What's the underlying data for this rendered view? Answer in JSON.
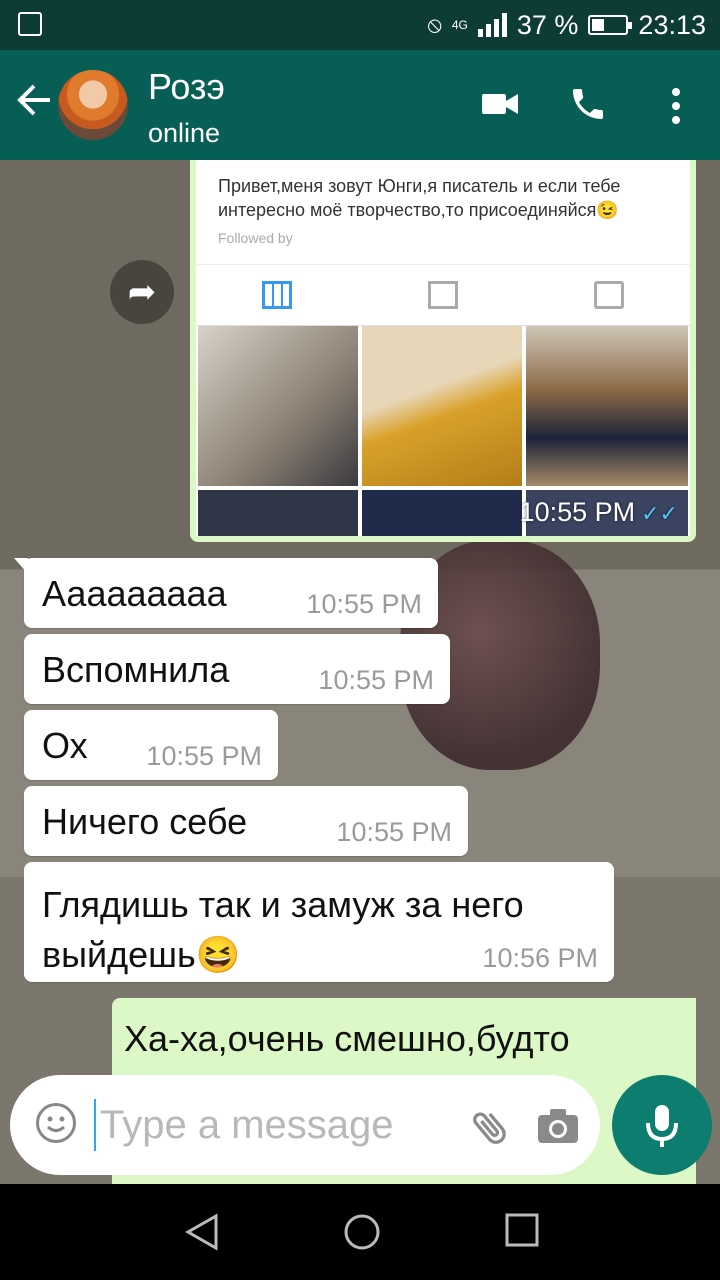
{
  "status": {
    "battery": "37 %",
    "time": "23:13",
    "network": "4G"
  },
  "header": {
    "title": "Розэ",
    "subtitle": "online"
  },
  "image_message": {
    "bio": "Привет,меня зовут Юнги,я писатель и если тебе интересно моё творчество,то присоединяйся😉",
    "followed_by": "Followed by",
    "time": "10:55 PM",
    "ticks": "✓✓"
  },
  "messages": [
    {
      "text": "Аааааааaa",
      "time": "10:55 PM"
    },
    {
      "text": "Вспомнила",
      "time": "10:55 PM"
    },
    {
      "text": "Ох",
      "time": "10:55 PM"
    },
    {
      "text": "Ничего себе",
      "time": "10:55 PM"
    },
    {
      "text": "Глядишь так и замуж за него выйдешь😆",
      "time": "10:56 PM"
    }
  ],
  "outgoing": {
    "text": "Ха-ха,очень смешно,будто"
  },
  "input": {
    "placeholder": "Type a message"
  },
  "colors": {
    "header": "#075e54",
    "statusbar": "#0d3b36",
    "outgoing_bubble": "#dcf8c6",
    "mic": "#0c7d6e",
    "ticks": "#4fc3f7"
  }
}
